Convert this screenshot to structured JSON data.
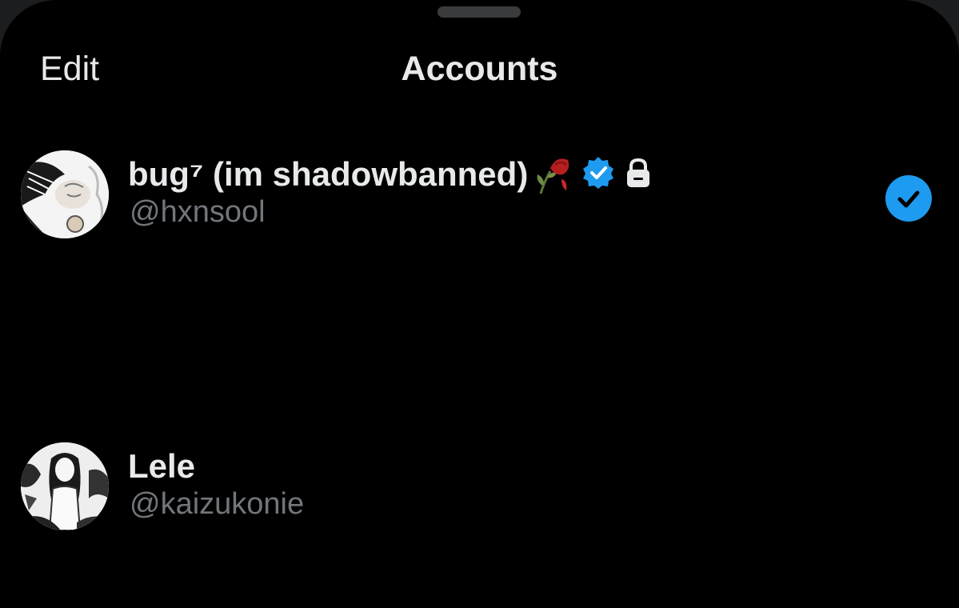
{
  "header": {
    "edit_label": "Edit",
    "title": "Accounts"
  },
  "accounts": [
    {
      "display_name": "bug⁷ (im shadowbanned)",
      "handle": "@hxnsool",
      "emoji": "wilted-rose-icon",
      "verified": true,
      "protected": true,
      "selected": true
    },
    {
      "display_name": "Lele",
      "handle": "@kaizukonie",
      "verified": false,
      "protected": false,
      "selected": false
    }
  ],
  "colors": {
    "background": "#000000",
    "text_primary": "#e7e9ea",
    "text_secondary": "#71767b",
    "accent_blue": "#1d9bf0"
  }
}
